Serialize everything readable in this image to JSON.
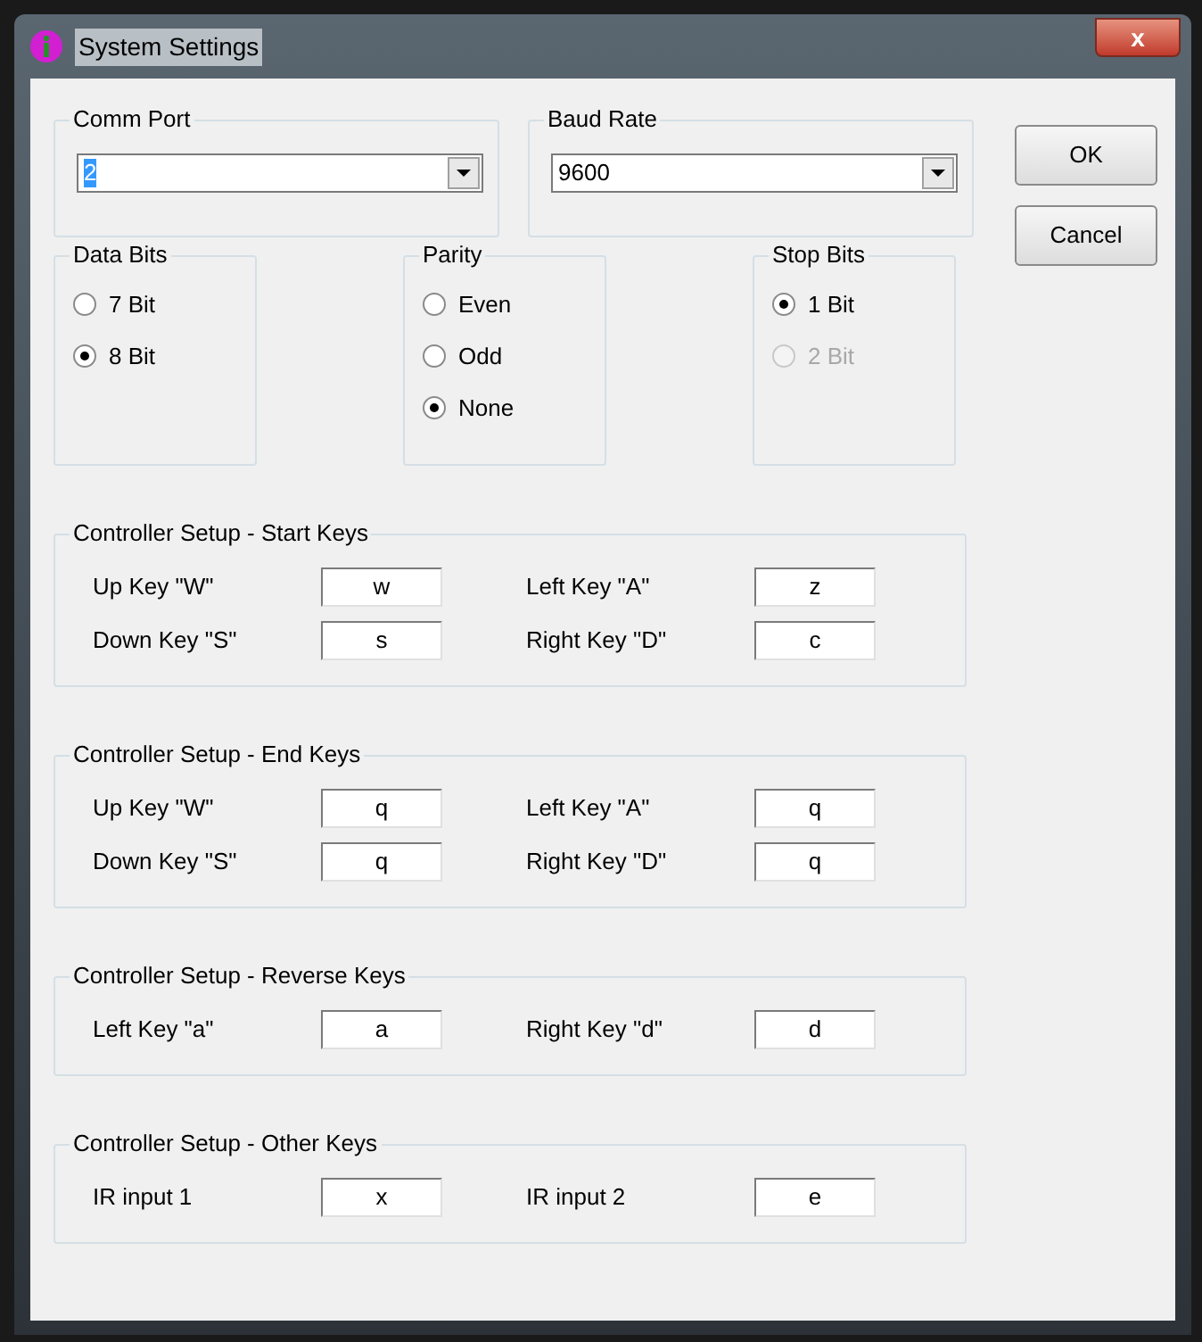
{
  "window": {
    "title": "System Settings",
    "close_label": "x"
  },
  "comm_port": {
    "label": "Comm Port",
    "value": "2",
    "text_selected": true
  },
  "baud_rate": {
    "label": "Baud Rate",
    "value": "9600",
    "text_selected": false
  },
  "buttons": [
    {
      "label": "OK"
    },
    {
      "label": "Cancel"
    }
  ],
  "radio_groups": [
    {
      "label": "Data Bits",
      "options": [
        {
          "label": "7 Bit",
          "selected": false,
          "disabled": false
        },
        {
          "label": "8 Bit",
          "selected": true,
          "disabled": false
        }
      ]
    },
    {
      "label": "Parity",
      "options": [
        {
          "label": "Even",
          "selected": false,
          "disabled": false
        },
        {
          "label": "Odd",
          "selected": false,
          "disabled": false
        },
        {
          "label": "None",
          "selected": true,
          "disabled": false
        }
      ]
    },
    {
      "label": "Stop Bits",
      "options": [
        {
          "label": "1 Bit",
          "selected": true,
          "disabled": false
        },
        {
          "label": "2 Bit",
          "selected": false,
          "disabled": true
        }
      ]
    }
  ],
  "key_groups": [
    {
      "title": "Controller Setup - Start Keys",
      "rows": [
        [
          {
            "label": "Up Key \"W\"",
            "value": "w"
          },
          {
            "label": "Left Key \"A\"",
            "value": "z"
          }
        ],
        [
          {
            "label": "Down Key \"S\"",
            "value": "s"
          },
          {
            "label": "Right Key \"D\"",
            "value": "c"
          }
        ]
      ]
    },
    {
      "title": "Controller Setup - End Keys",
      "rows": [
        [
          {
            "label": "Up Key \"W\"",
            "value": "q"
          },
          {
            "label": "Left Key \"A\"",
            "value": "q"
          }
        ],
        [
          {
            "label": "Down Key \"S\"",
            "value": "q"
          },
          {
            "label": "Right Key \"D\"",
            "value": "q"
          }
        ]
      ]
    },
    {
      "title": "Controller Setup - Reverse Keys",
      "rows": [
        [
          {
            "label": "Left Key \"a\"",
            "value": "a"
          },
          {
            "label": "Right Key \"d\"",
            "value": "d"
          }
        ]
      ]
    },
    {
      "title": "Controller Setup - Other Keys",
      "rows": [
        [
          {
            "label": "IR input 1",
            "value": "x"
          },
          {
            "label": "IR input 2",
            "value": "e"
          }
        ]
      ]
    }
  ]
}
